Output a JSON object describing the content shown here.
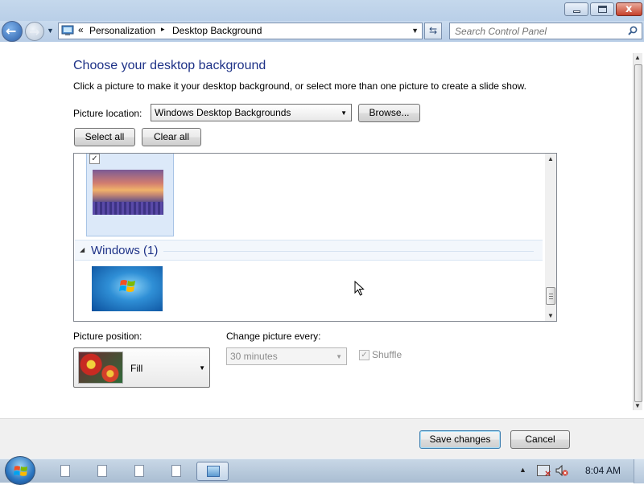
{
  "window": {
    "min_label": "",
    "max_label": "",
    "close_label": "x"
  },
  "address": {
    "chevron": "«",
    "crumbs": [
      "Personalization",
      "Desktop Background"
    ],
    "separator": "▸"
  },
  "search": {
    "placeholder": "Search Control Panel"
  },
  "page": {
    "heading": "Choose your desktop background",
    "description": "Click a picture to make it your desktop background, or select more than one picture to create a slide show."
  },
  "picture_location": {
    "label": "Picture location:",
    "value": "Windows Desktop Backgrounds",
    "browse": "Browse..."
  },
  "selection_buttons": {
    "select_all": "Select all",
    "clear_all": "Clear all"
  },
  "gallery": {
    "items": [
      {
        "name": "sunset-lake",
        "checked": true,
        "check_mark": "✓"
      },
      {
        "name": "windows-7",
        "checked": false
      }
    ],
    "group": {
      "label": "Windows (1)",
      "collapse_glyph": "◢"
    }
  },
  "picture_position": {
    "label": "Picture position:",
    "value": "Fill"
  },
  "change_picture": {
    "label": "Change picture every:",
    "value": "30 minutes",
    "enabled": false
  },
  "shuffle": {
    "label": "Shuffle",
    "checked": true,
    "enabled": false,
    "check_mark": "✓"
  },
  "footer": {
    "save": "Save changes",
    "cancel": "Cancel"
  },
  "taskbar": {
    "items": [
      "document",
      "document",
      "document",
      "document",
      "personalization-panel"
    ],
    "active_item": "personalization-panel",
    "clock": "8:04 AM"
  },
  "colors": {
    "heading_blue": "#1e3287",
    "selection_bg": "#dce9f9",
    "chrome_blue": "#b9cfe8"
  }
}
